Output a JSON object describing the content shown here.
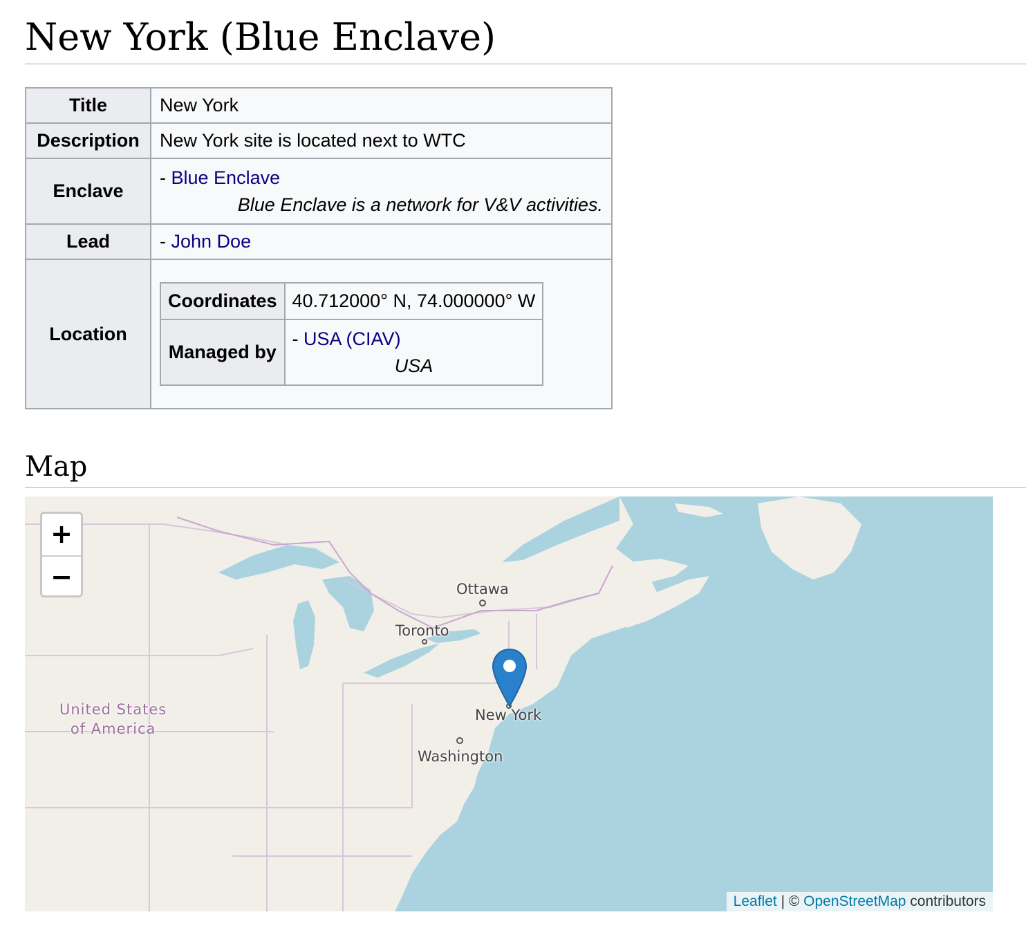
{
  "page": {
    "title": "New York (Blue Enclave)"
  },
  "infobox": {
    "title_label": "Title",
    "title_value": "New York",
    "description_label": "Description",
    "description_value": "New York site is located next to WTC",
    "enclave_label": "Enclave",
    "enclave_prefix": "- ",
    "enclave_link": "Blue Enclave",
    "enclave_desc": "Blue Enclave is a network for V&V activities.",
    "lead_label": "Lead",
    "lead_prefix": "- ",
    "lead_link": "John Doe",
    "location_label": "Location",
    "location": {
      "coordinates_label": "Coordinates",
      "coordinates_value": "40.712000° N, 74.000000° W",
      "managed_label": "Managed by",
      "managed_prefix": "- ",
      "managed_link": "USA (CIAV)",
      "managed_sub": "USA"
    }
  },
  "map_section": {
    "heading": "Map",
    "zoom_in": "+",
    "zoom_out": "−",
    "labels": {
      "country_line1": "United States",
      "country_line2": "of America",
      "ottawa": "Ottawa",
      "toronto": "Toronto",
      "new_york": "New York",
      "washington": "Washington"
    },
    "attribution": {
      "leaflet": "Leaflet",
      "separator": " | © ",
      "osm": "OpenStreetMap",
      "suffix": " contributors"
    },
    "marker_icon": "map-pin-icon",
    "colors": {
      "water": "#aad3df",
      "land": "#f2efe9",
      "border": "#c9a6cd",
      "marker": "#2a81cb"
    }
  }
}
